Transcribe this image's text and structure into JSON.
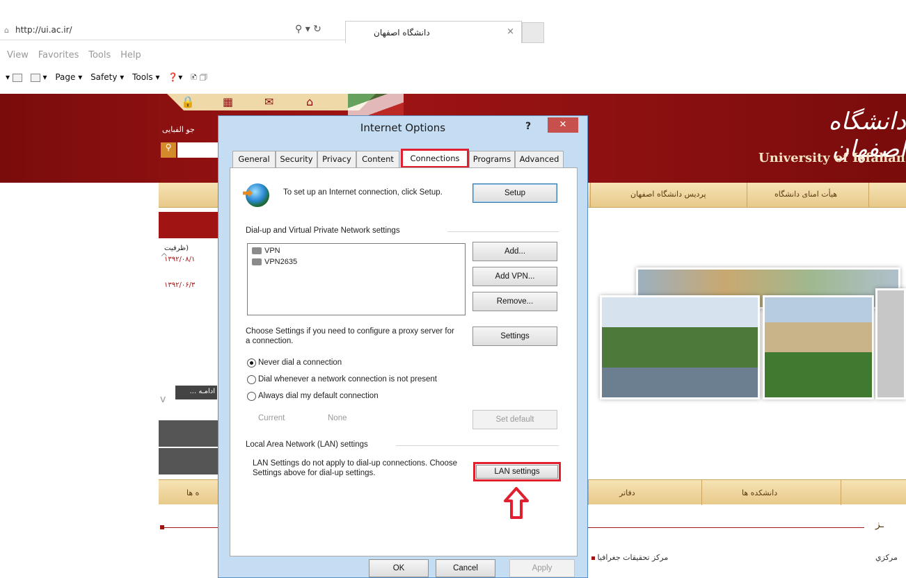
{
  "browser": {
    "url": "http://ui.ac.ir/",
    "tab_title": "دانشگاه اصفهان",
    "tab_close": "×",
    "search_icon": "search-icon",
    "menu": [
      "View",
      "Favorites",
      "Tools",
      "Help"
    ],
    "commands": [
      "Page ▾",
      "Safety ▾",
      "Tools ▾"
    ]
  },
  "site": {
    "logo_fa": "دانشگاه اصفهان",
    "logo_en": "University of Isfahan",
    "top_left_text": "جو الفبایی",
    "nav": [
      "پردیس دانشگاه اصفهان",
      "هیأت امنای دانشگاه"
    ],
    "news_lines": [
      "ظرفیت)",
      "۱۳۹۲/۰۸/۱",
      "۱۳۹۲/۰۶/۳"
    ],
    "news_more": "ادامـه ...",
    "bar2": [
      "دفاتر",
      "دانشکده ها",
      "ه ها"
    ],
    "center_title": "ـز",
    "center_items": [
      "مرکز تحقیقات جغرافیا",
      "مرکزي"
    ]
  },
  "dialog": {
    "title": "Internet Options",
    "help": "?",
    "close": "✕",
    "tabs": [
      "General",
      "Security",
      "Privacy",
      "Content",
      "Connections",
      "Programs",
      "Advanced"
    ],
    "active_tab": "Connections",
    "setup_text": "To set up an Internet connection, click Setup.",
    "setup_button": "Setup",
    "dialup_group": "Dial-up and Virtual Private Network settings",
    "vpn_items": [
      "VPN",
      "VPN2635"
    ],
    "add_button": "Add...",
    "add_vpn_button": "Add VPN...",
    "remove_button": "Remove...",
    "proxy_text": "Choose Settings if you need to configure a proxy server for a connection.",
    "settings_button": "Settings",
    "radios": [
      {
        "label": "Never dial a connection",
        "selected": true
      },
      {
        "label": "Dial whenever a network connection is not present",
        "selected": false
      },
      {
        "label": "Always dial my default connection",
        "selected": false
      }
    ],
    "current_label": "Current",
    "current_value": "None",
    "set_default_button": "Set default",
    "lan_group": "Local Area Network (LAN) settings",
    "lan_text": "LAN Settings do not apply to dial-up connections. Choose Settings above for dial-up settings.",
    "lan_button": "LAN settings",
    "ok_button": "OK",
    "cancel_button": "Cancel",
    "apply_button": "Apply"
  },
  "colors": {
    "highlight": "#e0202e",
    "banner": "#a01414",
    "dialog_frame": "#c4ddf3"
  }
}
